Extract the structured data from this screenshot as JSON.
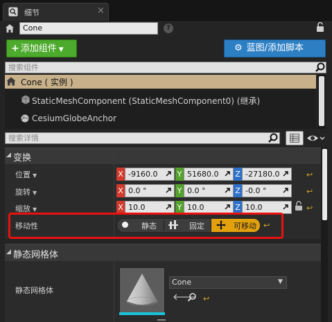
{
  "tab": {
    "label": "细节",
    "close": "×"
  },
  "actor": {
    "name": "Cone",
    "help": "?"
  },
  "toolbar": {
    "add_component_label": "添加组件",
    "add_component_plus": "+",
    "blueprint_label": "蓝图/添加脚本"
  },
  "component_search": {
    "placeholder": "搜索组件"
  },
  "components": [
    {
      "label": "Cone ( 实例 )",
      "selected": true,
      "icon": "actor-icon"
    },
    {
      "label": "StaticMeshComponent (StaticMeshComponent0) (继承)",
      "icon": "static-mesh-component-icon"
    },
    {
      "label": "CesiumGlobeAnchor",
      "icon": "globe-anchor-icon"
    }
  ],
  "details_search": {
    "placeholder": "搜索详情"
  },
  "transform": {
    "title": "变换",
    "rows": [
      {
        "label": "位置",
        "x": "-9160.0",
        "y": "51680.0",
        "z": "-27180.0"
      },
      {
        "label": "旋转",
        "x": "0.0 °",
        "y": "0.0 °",
        "z": "-0.0 °"
      },
      {
        "label": "缩放",
        "x": "10.0",
        "y": "10.0",
        "z": "10.0"
      }
    ],
    "axis_labels": {
      "x": "X",
      "y": "Y",
      "z": "Z"
    }
  },
  "mobility": {
    "label": "移动性",
    "options": [
      "静态",
      "固定",
      "可移动"
    ],
    "selected": "可移动"
  },
  "static_mesh": {
    "title": "静态网格体",
    "property_label": "静态网格体",
    "value": "Cone"
  },
  "colors": {
    "add_button": "#4caa2c",
    "blueprint_button": "#2d7fc4",
    "selected_row": "#c8b18a",
    "axis_x": "#d13a2c",
    "axis_y": "#55a12d",
    "axis_z": "#2c70c9",
    "mobility_selected": "#e3a10e",
    "highlight_box": "#e8120e"
  }
}
